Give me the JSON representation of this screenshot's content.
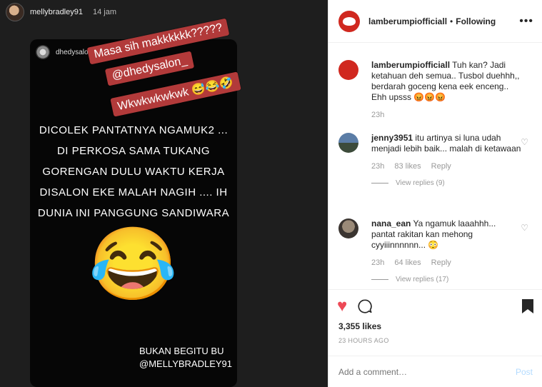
{
  "story": {
    "username": "mellybradley91",
    "time": "14 jam",
    "card_username": "dhedysalon_",
    "stickers": [
      "Masa sih makkkkkk?????",
      "@dhedysalon_",
      "Wkwkwkwkwk 😅😂🤣"
    ],
    "text_lines": [
      "DICOLEK PANTATNYA NGAMUK2 ...",
      "DI PERKOSA SAMA TUKANG",
      "GORENGAN DULU WAKTU KERJA",
      "DISALON EKE MALAH NAGIH .... IH",
      "DUNIA INI PANGGUNG SANDIWARA"
    ],
    "emoji": "😂",
    "sign_lines": [
      "BUKAN BEGITU BU",
      "@MELLYBRADLEY91"
    ]
  },
  "post": {
    "account": "lamberumpiofficiall",
    "separator": "•",
    "following": "Following",
    "more": "•••",
    "comments": [
      {
        "user": "lamberumpiofficiall",
        "text": "Tuh kan? Jadi ketahuan deh semua.. Tusbol duehhh,, berdarah goceng kena eek enceng.. Ehh upsss 😡😡😡",
        "time": "23h"
      },
      {
        "user": "jenny3951",
        "text": "itu artinya si luna udah menjadi lebih baik... malah di ketawaan",
        "time": "23h",
        "likes": "83 likes",
        "reply": "Reply",
        "view_replies": "View replies (9)"
      },
      {
        "user": "nana_ean",
        "text": "Ya ngamuk laaahhh... pantat rakitan kan mehong cyyiiinnnnnn... 😳",
        "time": "23h",
        "likes": "64 likes",
        "reply": "Reply",
        "view_replies": "View replies (17)"
      }
    ],
    "likes_count": "3,355 likes",
    "time_ago": "23 HOURS AGO",
    "add_comment_placeholder": "Add a comment…",
    "post_label": "Post"
  },
  "colors": {
    "like_red": "#ed4956",
    "sticker_red": "#b23a3a",
    "brand_red": "#d0281f",
    "post_disabled": "#b3dbff"
  },
  "icons": [
    "heart-icon",
    "comment-icon",
    "bookmark-icon",
    "more-icon"
  ]
}
